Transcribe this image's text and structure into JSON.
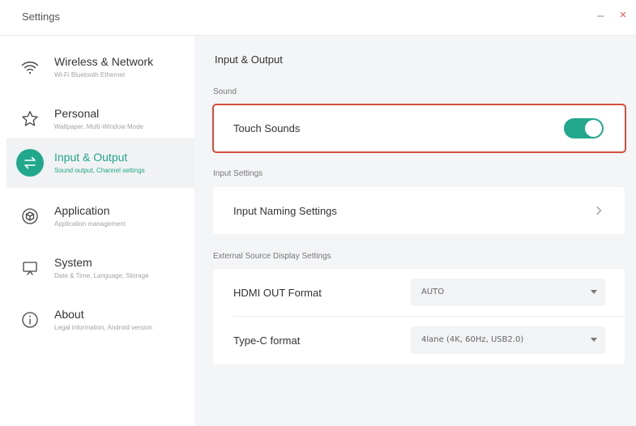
{
  "window": {
    "title": "Settings",
    "minimize_glyph": "–",
    "close_glyph": "×"
  },
  "sidebar": {
    "items": [
      {
        "icon": "wifi-icon",
        "label": "Wireless & Network",
        "sub": "Wi-Fi Bluetooth Ethernet",
        "active": false
      },
      {
        "icon": "star-icon",
        "label": "Personal",
        "sub": "Wallpaper, Multi-Window Mode",
        "active": false
      },
      {
        "icon": "swap-arrows-icon",
        "label": "Input & Output",
        "sub": "Sound output, Channel settings",
        "active": true
      },
      {
        "icon": "cube-icon",
        "label": "Application",
        "sub": "Application management",
        "active": false
      },
      {
        "icon": "monitor-icon",
        "label": "System",
        "sub": "Date & Time, Language, Storage",
        "active": false
      },
      {
        "icon": "info-icon",
        "label": "About",
        "sub": "Legal information, Android version",
        "active": false
      }
    ]
  },
  "main": {
    "title": "Input & Output",
    "sections": {
      "sound": {
        "label": "Sound",
        "touch_sounds": {
          "label": "Touch Sounds",
          "enabled": true
        }
      },
      "input": {
        "label": "Input Settings",
        "naming": {
          "label": "Input Naming Settings"
        }
      },
      "external": {
        "label": "External Source Display Settings",
        "hdmi_out": {
          "label": "HDMI OUT Format",
          "value": "AUTO"
        },
        "type_c": {
          "label": "Type-C format",
          "value": "4lane (4K, 60Hz, USB2.0)"
        }
      }
    }
  },
  "colors": {
    "accent": "#21a88c",
    "highlight_border": "#d44c3b",
    "close": "#e05a4f"
  }
}
